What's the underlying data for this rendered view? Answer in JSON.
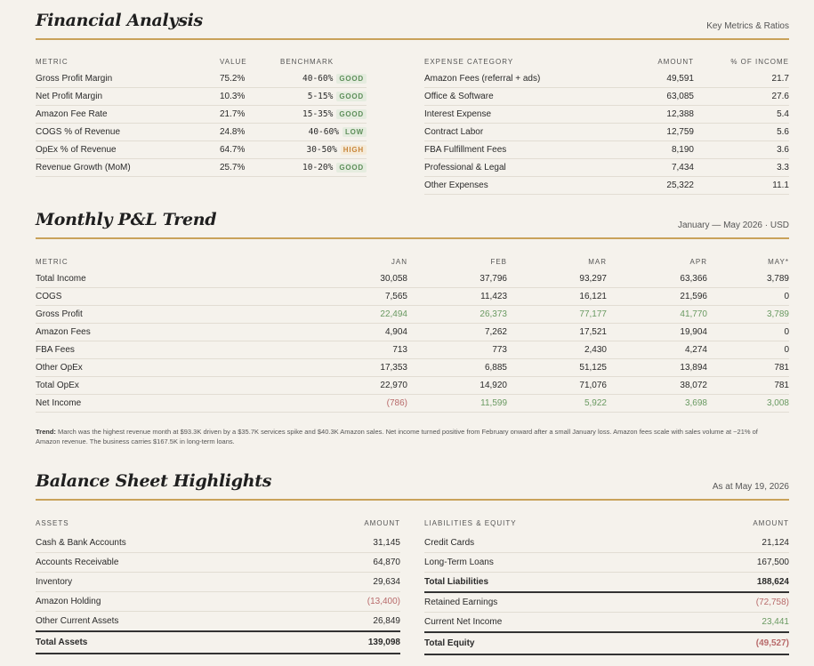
{
  "fa": {
    "title": "Financial Analysis",
    "note": "Key Metrics & Ratios",
    "metrics_headers": [
      "METRIC",
      "VALUE",
      "BENCHMARK"
    ],
    "metrics": [
      {
        "name": "Gross Profit Margin",
        "value": "75.2%",
        "bench": "40-60%",
        "tag": "GOOD"
      },
      {
        "name": "Net Profit Margin",
        "value": "10.3%",
        "bench": "5-15%",
        "tag": "GOOD"
      },
      {
        "name": "Amazon Fee Rate",
        "value": "21.7%",
        "bench": "15-35%",
        "tag": "GOOD"
      },
      {
        "name": "COGS % of Revenue",
        "value": "24.8%",
        "bench": "40-60%",
        "tag": "LOW"
      },
      {
        "name": "OpEx % of Revenue",
        "value": "64.7%",
        "bench": "30-50%",
        "tag": "HIGH"
      },
      {
        "name": "Revenue Growth (MoM)",
        "value": "25.7%",
        "bench": "10-20%",
        "tag": "GOOD"
      }
    ],
    "expense_headers": [
      "EXPENSE CATEGORY",
      "AMOUNT",
      "% OF INCOME"
    ],
    "expenses": [
      {
        "cat": "Amazon Fees (referral + ads)",
        "amount": "49,591",
        "pct": "21.7"
      },
      {
        "cat": "Office & Software",
        "amount": "63,085",
        "pct": "27.6"
      },
      {
        "cat": "Interest Expense",
        "amount": "12,388",
        "pct": "5.4"
      },
      {
        "cat": "Contract Labor",
        "amount": "12,759",
        "pct": "5.6"
      },
      {
        "cat": "FBA Fulfillment Fees",
        "amount": "8,190",
        "pct": "3.6"
      },
      {
        "cat": "Professional & Legal",
        "amount": "7,434",
        "pct": "3.3"
      },
      {
        "cat": "Other Expenses",
        "amount": "25,322",
        "pct": "11.1"
      }
    ]
  },
  "pl": {
    "title": "Monthly P&L Trend",
    "note": "January — May 2026 · USD",
    "headers": [
      "METRIC",
      "JAN",
      "FEB",
      "MAR",
      "APR",
      "MAY*"
    ],
    "rows": [
      {
        "metric": "Total Income",
        "v": [
          "30,058",
          "37,796",
          "93,297",
          "63,366",
          "3,789"
        ],
        "style": ""
      },
      {
        "metric": "COGS",
        "v": [
          "7,565",
          "11,423",
          "16,121",
          "21,596",
          "0"
        ],
        "style": ""
      },
      {
        "metric": "Gross Profit",
        "v": [
          "22,494",
          "26,373",
          "77,177",
          "41,770",
          "3,789"
        ],
        "style": "pos"
      },
      {
        "metric": "Amazon Fees",
        "v": [
          "4,904",
          "7,262",
          "17,521",
          "19,904",
          "0"
        ],
        "style": ""
      },
      {
        "metric": "FBA Fees",
        "v": [
          "713",
          "773",
          "2,430",
          "4,274",
          "0"
        ],
        "style": ""
      },
      {
        "metric": "Other OpEx",
        "v": [
          "17,353",
          "6,885",
          "51,125",
          "13,894",
          "781"
        ],
        "style": ""
      },
      {
        "metric": "Total OpEx",
        "v": [
          "22,970",
          "14,920",
          "71,076",
          "38,072",
          "781"
        ],
        "style": ""
      },
      {
        "metric": "Net Income",
        "v": [
          "(786)",
          "11,599",
          "5,922",
          "3,698",
          "3,008"
        ],
        "style": "pos",
        "neg_first": true
      }
    ],
    "trend_label": "Trend:",
    "trend_text": "March was the highest revenue month at $93.3K driven by a $35.7K services spike and $40.3K Amazon sales. Net income turned positive from February onward after a small January loss. Amazon fees scale with sales volume at ~21% of Amazon revenue. The business carries $167.5K in long-term loans."
  },
  "bs": {
    "title": "Balance Sheet Highlights",
    "note": "As at May 19, 2026",
    "assets_headers": [
      "ASSETS",
      "AMOUNT"
    ],
    "assets": [
      {
        "name": "Cash & Bank Accounts",
        "amount": "31,145",
        "neg": false
      },
      {
        "name": "Accounts Receivable",
        "amount": "64,870",
        "neg": false
      },
      {
        "name": "Inventory",
        "amount": "29,634",
        "neg": false
      },
      {
        "name": "Amazon Holding",
        "amount": "(13,400)",
        "neg": true
      },
      {
        "name": "Other Current Assets",
        "amount": "26,849",
        "neg": false
      }
    ],
    "assets_total": {
      "name": "Total Assets",
      "amount": "139,098"
    },
    "liab_headers": [
      "LIABILITIES & EQUITY",
      "AMOUNT"
    ],
    "liabilities": [
      {
        "name": "Credit Cards",
        "amount": "21,124",
        "neg": false,
        "bold": false
      },
      {
        "name": "Long-Term Loans",
        "amount": "167,500",
        "neg": false,
        "bold": false
      },
      {
        "name": "Total Liabilities",
        "amount": "188,624",
        "neg": false,
        "bold": true
      },
      {
        "name": "Retained Earnings",
        "amount": "(72,758)",
        "neg": true,
        "bold": false
      },
      {
        "name": "Current Net Income",
        "amount": "23,441",
        "pos": true,
        "bold": false
      }
    ],
    "liab_total": {
      "name": "Total Equity",
      "amount": "(49,527)",
      "neg": true
    }
  }
}
